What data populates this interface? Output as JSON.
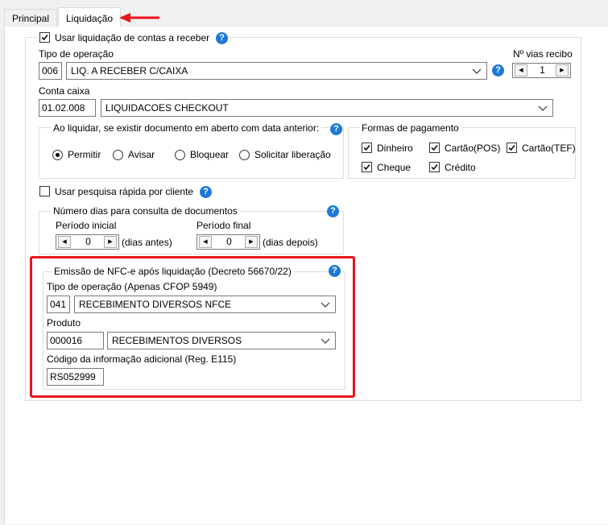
{
  "tabs": [
    "Principal",
    "Liquidação"
  ],
  "use_liquidation": {
    "label": "Usar liquidação de contas a receber",
    "checked": true
  },
  "operation_type": {
    "label": "Tipo de operação",
    "code": "006",
    "value": "LIQ. A RECEBER C/CAIXA"
  },
  "receipt_copies": {
    "label": "Nº vias recibo",
    "value": "1"
  },
  "cash_account": {
    "label": "Conta caixa",
    "code": "01.02.008",
    "value": "LIQUIDACOES CHECKOUT"
  },
  "open_document": {
    "legend": "Ao liquidar, se existir documento em aberto com data anterior:",
    "options": [
      "Permitir",
      "Avisar",
      "Bloquear",
      "Solicitar liberação"
    ],
    "selected": "Permitir"
  },
  "payment_methods": {
    "legend": "Formas de pagamento",
    "items": [
      {
        "label": "Dinheiro",
        "checked": true
      },
      {
        "label": "Cartão(POS)",
        "checked": true
      },
      {
        "label": "Cartão(TEF)",
        "checked": true
      },
      {
        "label": "Cheque",
        "checked": true
      },
      {
        "label": "Crédito",
        "checked": true
      }
    ]
  },
  "quick_search": {
    "label": "Usar pesquisa rápida por cliente",
    "checked": false
  },
  "days_range": {
    "legend": "Número dias para consulta de documentos",
    "start_label": "Período inicial",
    "start_value": "0",
    "start_suffix": "(dias antes)",
    "end_label": "Período final",
    "end_value": "0",
    "end_suffix": "(dias depois)"
  },
  "nfce": {
    "legend": "Emissão de NFC-e após liquidação (Decreto 56670/22)",
    "op_label": "Tipo de operação (Apenas CFOP 5949)",
    "op_code": "041",
    "op_value": "RECEBIMENTO DIVERSOS NFCE",
    "product_label": "Produto",
    "product_code": "000016",
    "product_value": "RECEBIMENTOS DIVERSOS",
    "info_label": "Código da informação adicional (Reg. E115)",
    "info_value": "RS052999"
  },
  "help_symbol": "?",
  "spin_left": "◀",
  "spin_right": "▶",
  "colors": {
    "highlight": "#e8141c",
    "help": "#1e7ad6",
    "annotation_arrow": "#e8141c"
  }
}
